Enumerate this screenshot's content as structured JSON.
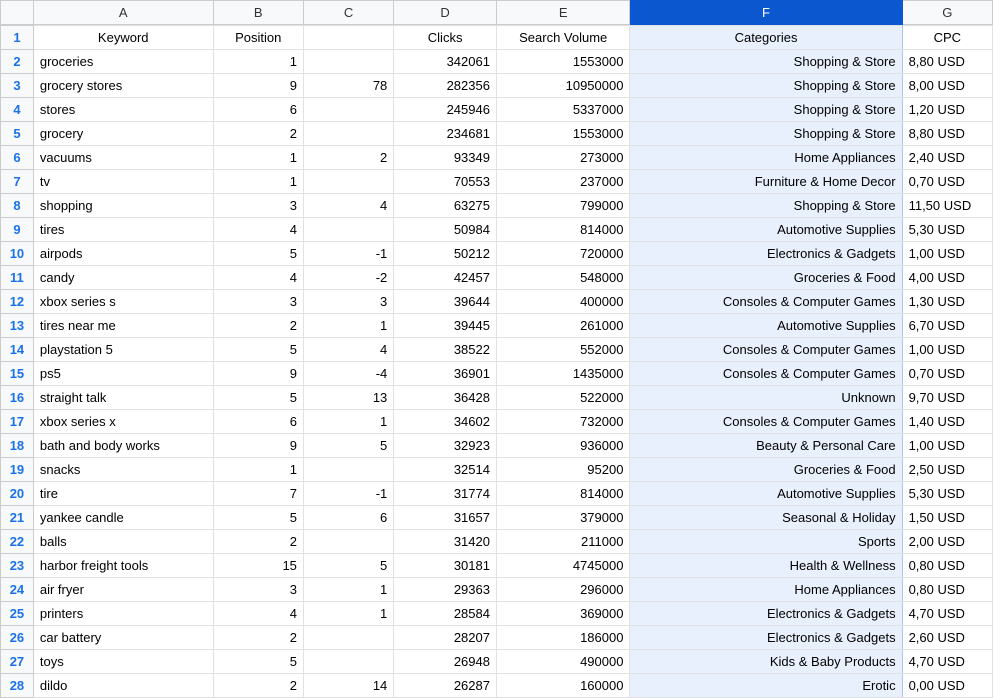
{
  "columns": [
    "A",
    "B",
    "C",
    "D",
    "E",
    "F",
    "G"
  ],
  "selectedColumn": "F",
  "chart_data": {
    "type": "table",
    "headers": [
      "Keyword",
      "Position",
      "",
      "Clicks",
      "Search Volume",
      "Categories",
      "CPC"
    ],
    "rows": [
      [
        "groceries",
        "1",
        "",
        "342061",
        "1553000",
        "Shopping & Store",
        "8,80 USD"
      ],
      [
        "grocery stores",
        "9",
        "78",
        "282356",
        "10950000",
        "Shopping & Store",
        "8,00 USD"
      ],
      [
        "stores",
        "6",
        "",
        "245946",
        "5337000",
        "Shopping & Store",
        "1,20 USD"
      ],
      [
        "grocery",
        "2",
        "",
        "234681",
        "1553000",
        "Shopping & Store",
        "8,80 USD"
      ],
      [
        "vacuums",
        "1",
        "2",
        "93349",
        "273000",
        "Home Appliances",
        "2,40 USD"
      ],
      [
        "tv",
        "1",
        "",
        "70553",
        "237000",
        "Furniture & Home Decor",
        "0,70 USD"
      ],
      [
        "shopping",
        "3",
        "4",
        "63275",
        "799000",
        "Shopping & Store",
        "11,50 USD"
      ],
      [
        "tires",
        "4",
        "",
        "50984",
        "814000",
        "Automotive Supplies",
        "5,30 USD"
      ],
      [
        "airpods",
        "5",
        "-1",
        "50212",
        "720000",
        "Electronics & Gadgets",
        "1,00 USD"
      ],
      [
        "candy",
        "4",
        "-2",
        "42457",
        "548000",
        "Groceries & Food",
        "4,00 USD"
      ],
      [
        "xbox series s",
        "3",
        "3",
        "39644",
        "400000",
        "Consoles & Computer Games",
        "1,30 USD"
      ],
      [
        "tires near me",
        "2",
        "1",
        "39445",
        "261000",
        "Automotive Supplies",
        "6,70 USD"
      ],
      [
        "playstation 5",
        "5",
        "4",
        "38522",
        "552000",
        "Consoles & Computer Games",
        "1,00 USD"
      ],
      [
        "ps5",
        "9",
        "-4",
        "36901",
        "1435000",
        "Consoles & Computer Games",
        "0,70 USD"
      ],
      [
        "straight talk",
        "5",
        "13",
        "36428",
        "522000",
        "Unknown",
        "9,70 USD"
      ],
      [
        "xbox series x",
        "6",
        "1",
        "34602",
        "732000",
        "Consoles & Computer Games",
        "1,40 USD"
      ],
      [
        "bath and body works",
        "9",
        "5",
        "32923",
        "936000",
        "Beauty & Personal Care",
        "1,00 USD"
      ],
      [
        "snacks",
        "1",
        "",
        "32514",
        "95200",
        "Groceries & Food",
        "2,50 USD"
      ],
      [
        "tire",
        "7",
        "-1",
        "31774",
        "814000",
        "Automotive Supplies",
        "5,30 USD"
      ],
      [
        "yankee candle",
        "5",
        "6",
        "31657",
        "379000",
        "Seasonal & Holiday",
        "1,50 USD"
      ],
      [
        "balls",
        "2",
        "",
        "31420",
        "211000",
        "Sports",
        "2,00 USD"
      ],
      [
        "harbor freight tools",
        "15",
        "5",
        "30181",
        "4745000",
        "Health & Wellness",
        "0,80 USD"
      ],
      [
        "air fryer",
        "3",
        "1",
        "29363",
        "296000",
        "Home Appliances",
        "0,80 USD"
      ],
      [
        "printers",
        "4",
        "1",
        "28584",
        "369000",
        "Electronics & Gadgets",
        "4,70 USD"
      ],
      [
        "car battery",
        "2",
        "",
        "28207",
        "186000",
        "Electronics & Gadgets",
        "2,60 USD"
      ],
      [
        "toys",
        "5",
        "",
        "26948",
        "490000",
        "Kids & Baby Products",
        "4,70 USD"
      ],
      [
        "dildo",
        "2",
        "14",
        "26287",
        "160000",
        "Erotic",
        "0,00 USD"
      ]
    ]
  }
}
